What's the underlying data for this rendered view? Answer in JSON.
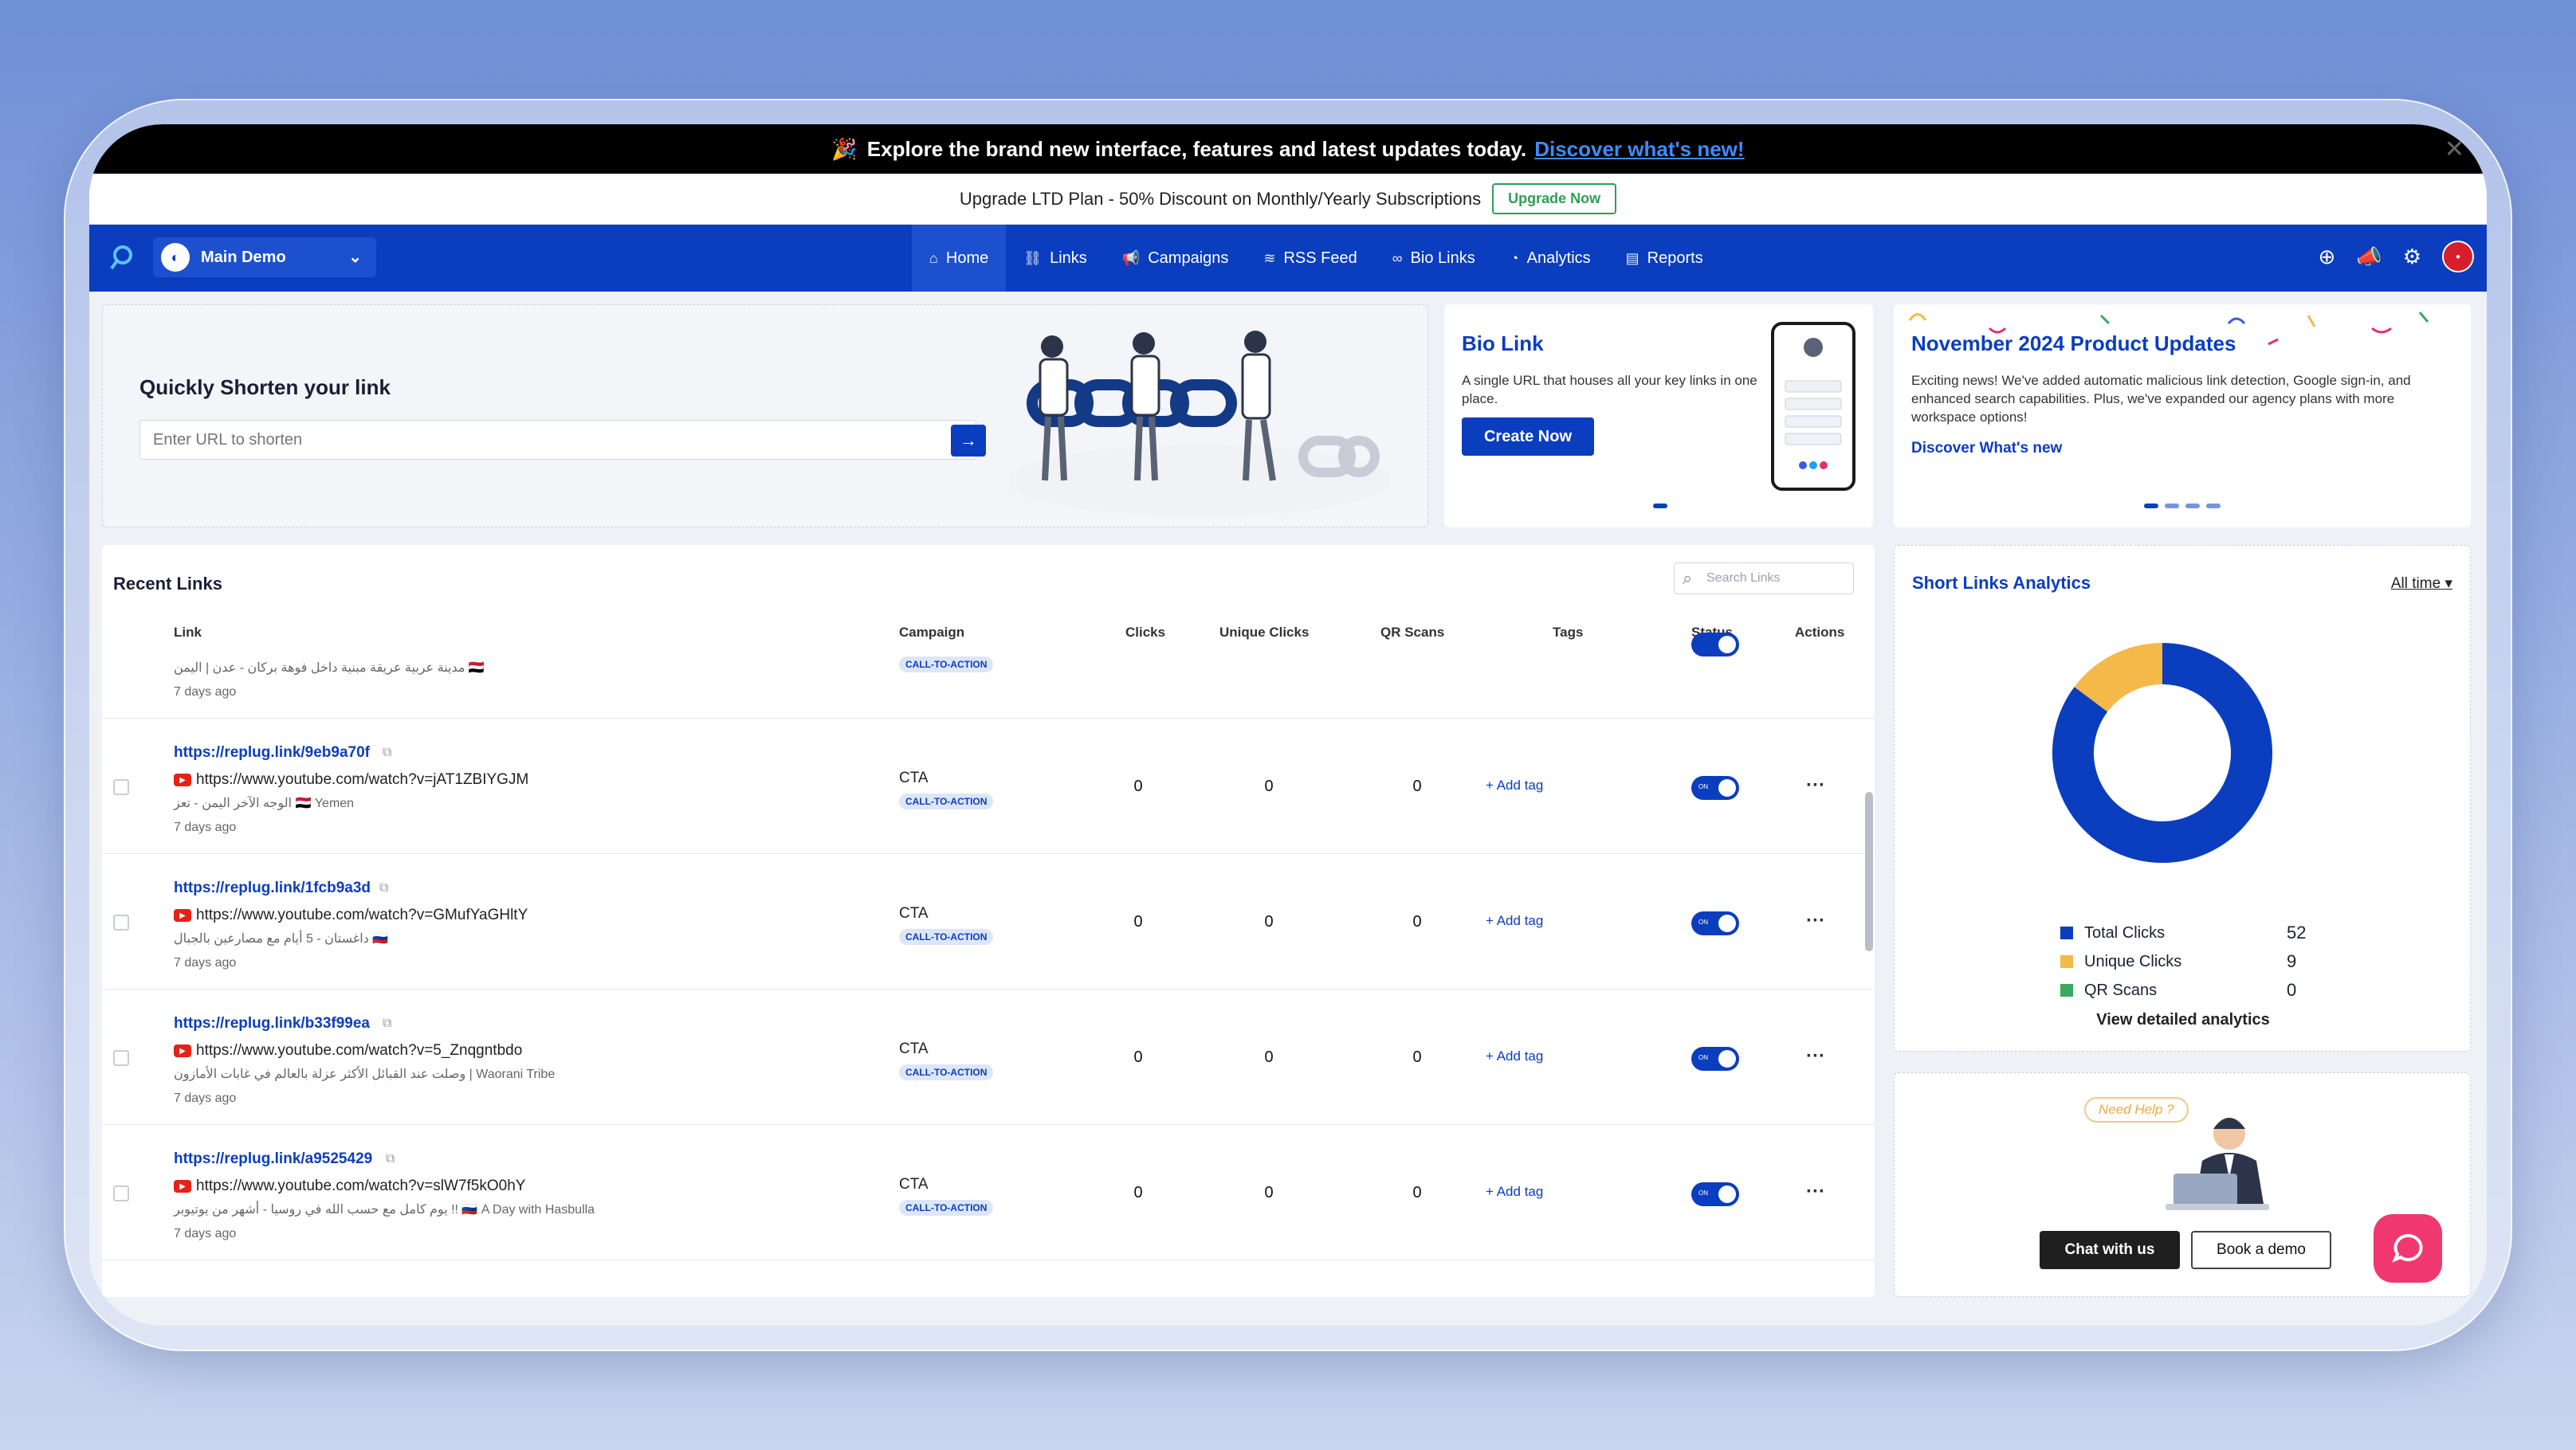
{
  "announcement": {
    "text": "Explore the brand new interface, features and latest updates today.",
    "link": "Discover what's new!",
    "close": "✕"
  },
  "promo": {
    "text": "Upgrade LTD Plan - 50% Discount on Monthly/Yearly Subscriptions",
    "button": "Upgrade Now"
  },
  "nav": {
    "workspace": "Main Demo",
    "items": [
      {
        "label": "Home",
        "icon": "home-icon",
        "active": true
      },
      {
        "label": "Links",
        "icon": "link-icon"
      },
      {
        "label": "Campaigns",
        "icon": "megaphone-icon"
      },
      {
        "label": "RSS Feed",
        "icon": "rss-icon"
      },
      {
        "label": "Bio Links",
        "icon": "bio-link-icon"
      },
      {
        "label": "Analytics",
        "icon": "analytics-icon"
      },
      {
        "label": "Reports",
        "icon": "report-icon"
      }
    ]
  },
  "shorten": {
    "title": "Quickly Shorten your link",
    "placeholder": "Enter URL to shorten"
  },
  "bio": {
    "title": "Bio Link",
    "description": "A single URL that houses all your key links in one place.",
    "button": "Create Now"
  },
  "updates": {
    "title": "November 2024 Product Updates",
    "text": "Exciting news! We've added automatic malicious link detection, Google sign-in, and enhanced search capabilities. Plus, we've expanded our agency plans with more workspace options!",
    "link": "Discover What's new"
  },
  "recent": {
    "title": "Recent Links",
    "search_placeholder": "Search Links",
    "columns": [
      "Link",
      "Campaign",
      "Clicks",
      "Unique Clicks",
      "QR Scans",
      "Tags",
      "Status",
      "Actions"
    ],
    "partial_row": {
      "sub": "مدينة عربية عريقة مبنية داخل فوهة بركان - عدن | اليمن 🇾🇪",
      "age": "7 days ago",
      "badge": "CALL-TO-ACTION"
    },
    "rows": [
      {
        "short": "https://replug.link/9eb9a70f",
        "long": "https://www.youtube.com/watch?v=jAT1ZBIYGJM",
        "sub": "الوجه الآخر اليمن - تعز 🇾🇪 Yemen",
        "age": "7 days ago",
        "campaign": "CTA",
        "badge": "CALL-TO-ACTION",
        "clicks": "0",
        "unique": "0",
        "qr": "0",
        "tag": "Add tag",
        "toggle": "ON",
        "status": "on"
      },
      {
        "short": "https://replug.link/1fcb9a3d",
        "long": "https://www.youtube.com/watch?v=GMufYaGHltY",
        "sub": "داغستان - 5 أيام مع مصارعين بالجبال 🇷🇺",
        "age": "7 days ago",
        "campaign": "CTA",
        "badge": "CALL-TO-ACTION",
        "clicks": "0",
        "unique": "0",
        "qr": "0",
        "tag": "Add tag",
        "toggle": "ON",
        "status": "on"
      },
      {
        "short": "https://replug.link/b33f99ea",
        "long": "https://www.youtube.com/watch?v=5_Znqgntbdo",
        "sub": "وصلت عند القبائل الأكثر عزلة بالعالم في غابات الأمازون | Waorani Tribe",
        "age": "7 days ago",
        "campaign": "CTA",
        "badge": "CALL-TO-ACTION",
        "clicks": "0",
        "unique": "0",
        "qr": "0",
        "tag": "Add tag",
        "toggle": "ON",
        "status": "on"
      },
      {
        "short": "https://replug.link/a9525429",
        "long": "https://www.youtube.com/watch?v=slW7f5kO0hY",
        "sub": "يوم كامل مع حسب الله في روسيا - أشهر من يوتيوبر !! 🇷🇺 A Day with Hasbulla",
        "age": "7 days ago",
        "campaign": "CTA",
        "badge": "CALL-TO-ACTION",
        "clicks": "0",
        "unique": "0",
        "qr": "0",
        "tag": "Add tag",
        "toggle": "ON",
        "status": "on"
      }
    ]
  },
  "analytics": {
    "title": "Short Links Analytics",
    "range": "All time",
    "detail": "View detailed analytics",
    "colors": {
      "total": "#0b3dbf",
      "unique": "#f5b94a",
      "qr": "#3aaa5c"
    }
  },
  "chart_data": {
    "type": "pie",
    "categories": [
      "Total Clicks",
      "Unique Clicks",
      "QR Scans"
    ],
    "values": [
      52,
      9,
      0
    ]
  },
  "help": {
    "bubble": "Need Help ?",
    "chat": "Chat with us",
    "demo": "Book a demo"
  }
}
